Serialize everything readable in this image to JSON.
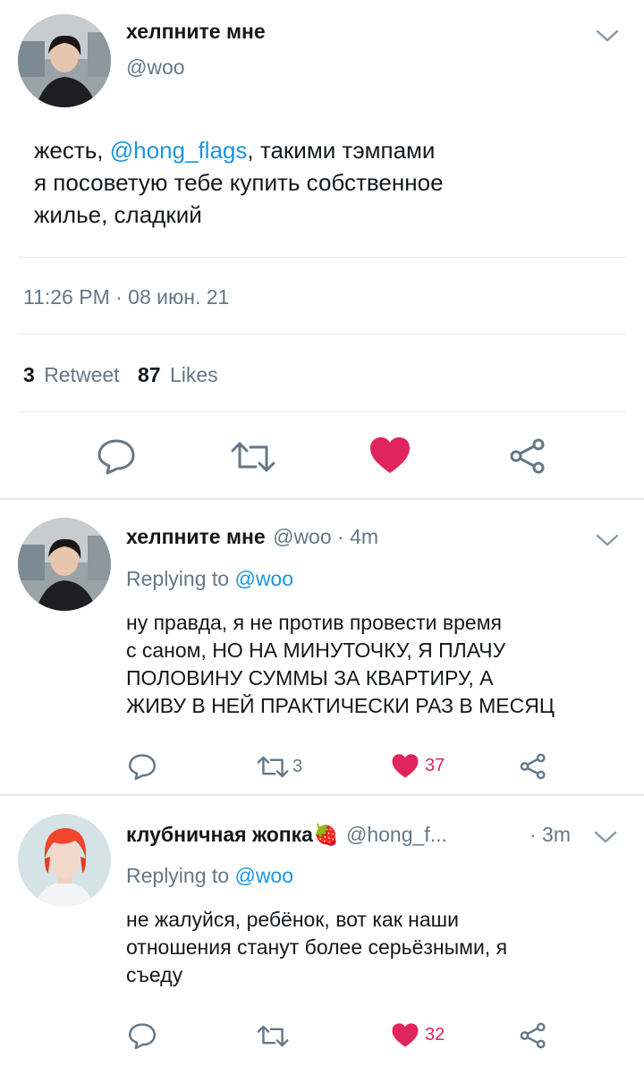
{
  "main_tweet": {
    "display_name": "хелпните мне",
    "handle": "@woo",
    "text_before": "жесть, ",
    "mention": "@hong_flags",
    "text_after_line1": ", такими тэмпами",
    "text_line2": "я посоветую тебе купить собственное",
    "text_line3": "жилье, сладкий",
    "timestamp": "11:26 PM · 08 июн. 21",
    "retweet_count": "3",
    "retweet_label": "Retweet",
    "like_count": "87",
    "like_label": "Likes"
  },
  "replies": [
    {
      "display_name": "хелпните мне",
      "handle": "@woo",
      "time": "· 4m",
      "replying_label": "Replying to",
      "replying_to": "@woo",
      "lines": [
        "ну правда, я не против провести время",
        "с саном, НО НА МИНУТОЧКУ, Я ПЛАЧУ",
        "ПОЛОВИНУ СУММЫ ЗА КВАРТИРУ, А",
        "ЖИВУ В НЕЙ ПРАКТИЧЕСКИ РАЗ В МЕСЯЦ"
      ],
      "retweets": "3",
      "likes": "37"
    },
    {
      "display_name": "клубничная жопка",
      "emoji": "🍓",
      "handle": "@hong_f...",
      "time": "· 3m",
      "replying_label": "Replying to",
      "replying_to": "@woo",
      "lines": [
        "не жалуйся, ребёнок, вот как наши",
        "отношения станут более серьёзными, я",
        "съеду"
      ],
      "retweets": "",
      "likes": "32"
    }
  ],
  "icons": {
    "reply": "reply-icon",
    "retweet": "retweet-icon",
    "like": "heart-icon",
    "share": "share-icon",
    "more": "chevron-down-icon"
  },
  "colors": {
    "like_red": "#e0245e",
    "link_blue": "#1b95e0",
    "secondary_gray": "#657786"
  }
}
